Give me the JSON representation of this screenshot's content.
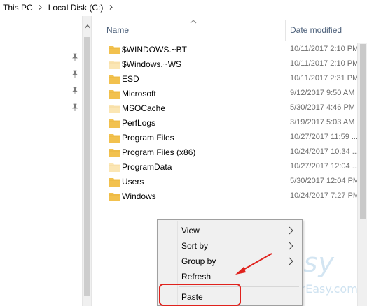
{
  "breadcrumb": {
    "items": [
      "This PC",
      "Local Disk (C:)"
    ]
  },
  "columns": {
    "name": "Name",
    "date_modified": "Date modified"
  },
  "files": [
    {
      "name": "$WINDOWS.~BT",
      "date": "10/11/2017 2:10 PM",
      "icon": "folder-icon",
      "faded": false
    },
    {
      "name": "$Windows.~WS",
      "date": "10/11/2017 2:10 PM",
      "icon": "folder-icon",
      "faded": true
    },
    {
      "name": "ESD",
      "date": "10/11/2017 2:31 PM",
      "icon": "folder-icon",
      "faded": false
    },
    {
      "name": "Microsoft",
      "date": "9/12/2017 9:50 AM",
      "icon": "folder-icon",
      "faded": false
    },
    {
      "name": "MSOCache",
      "date": "5/30/2017 4:46 PM",
      "icon": "folder-icon",
      "faded": true
    },
    {
      "name": "PerfLogs",
      "date": "3/19/2017 5:03 AM",
      "icon": "folder-icon",
      "faded": false
    },
    {
      "name": "Program Files",
      "date": "10/27/2017 11:59 ...",
      "icon": "folder-icon",
      "faded": false
    },
    {
      "name": "Program Files (x86)",
      "date": "10/24/2017 10:34 ...",
      "icon": "folder-icon",
      "faded": false
    },
    {
      "name": "ProgramData",
      "date": "10/27/2017 12:04 ...",
      "icon": "folder-icon",
      "faded": true
    },
    {
      "name": "Users",
      "date": "5/30/2017 12:04 PM",
      "icon": "folder-icon",
      "faded": false
    },
    {
      "name": "Windows",
      "date": "10/24/2017 7:27 PM",
      "icon": "folder-icon",
      "faded": false
    }
  ],
  "context_menu": {
    "items": [
      {
        "label": "View",
        "has_submenu": true
      },
      {
        "label": "Sort by",
        "has_submenu": true
      },
      {
        "label": "Group by",
        "has_submenu": true
      },
      {
        "label": "Refresh",
        "has_submenu": false
      },
      {
        "label": "Paste",
        "has_submenu": false
      }
    ]
  },
  "watermark": {
    "brand": "driver easy",
    "url": "www.DriverEasy.com"
  },
  "colors": {
    "folder": "#f2c14e",
    "folder_faded": "#fbe6b4",
    "highlight": "#e0221d",
    "header_text": "#4c607a"
  }
}
